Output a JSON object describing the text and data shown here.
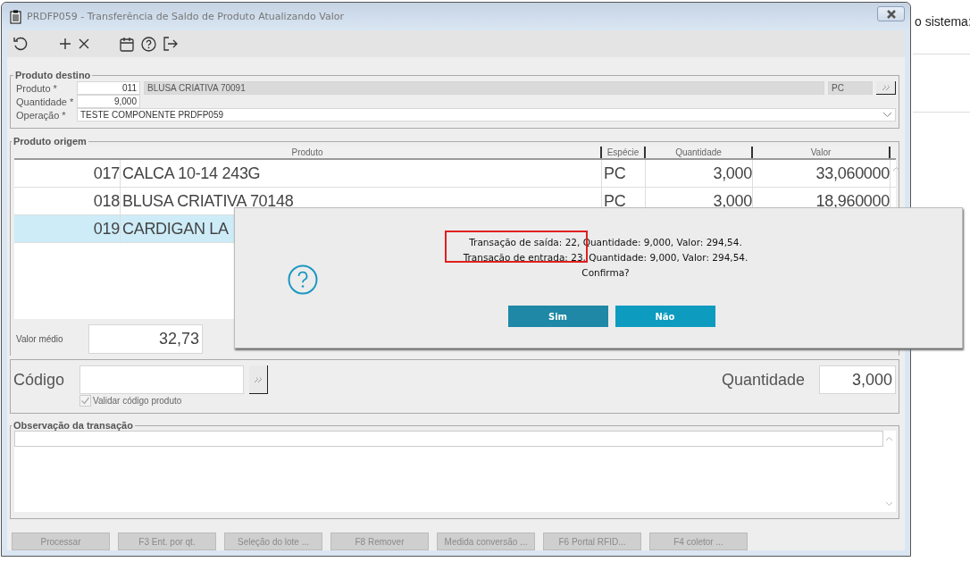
{
  "background": {
    "text": "o sistema:"
  },
  "window": {
    "title": "PRDFP059 - Transferência de Saldo de Produto Atualizando Valor"
  },
  "destino": {
    "title": "Produto destino",
    "fields": [
      {
        "label": "Produto *",
        "code": "011",
        "name": "BLUSA CRIATIVA 70091",
        "unit": "PC"
      },
      {
        "label": "Quantidade *",
        "value": "9,000"
      },
      {
        "label": "Operação *",
        "value": "TESTE COMPONENTE PRDFP059"
      }
    ]
  },
  "origem": {
    "title": "Produto origem",
    "table": {
      "columns": [
        "Produto",
        "Espécie",
        "Quantidade",
        "Valor"
      ],
      "rows": [
        {
          "product": {
            "code": "017",
            "name": "CALCA 10-14 243G"
          },
          "cells": [
            "PC",
            "3,000",
            "33,060000"
          ],
          "selected": false
        },
        {
          "product": {
            "code": "018",
            "name": "BLUSA CRIATIVA 70148"
          },
          "cells": [
            "PC",
            "3,000",
            "18,960000"
          ],
          "selected": false
        },
        {
          "product": {
            "code": "019",
            "name": "CARDIGAN LA"
          },
          "selected": true
        }
      ]
    },
    "average": {
      "label": "Valor médio",
      "value": "32,73"
    }
  },
  "codigo": {
    "label": "Código",
    "checkbox": {
      "label": "Validar código produto",
      "checked": true
    },
    "quantity_label": "Quantidade",
    "quantity": "3,000"
  },
  "observacao": {
    "title": "Observação da transação"
  },
  "buttons": [
    {
      "label": "Processar",
      "disabled": true
    },
    {
      "label": "F3 Ent. por qt.",
      "disabled": true
    },
    {
      "label": "Seleção do lote ...",
      "disabled": true
    },
    {
      "label": "F8 Remover",
      "disabled": true
    },
    {
      "label": "Medida conversão ...",
      "disabled": true
    },
    {
      "label": "F6 Portal RFID...",
      "disabled": true
    },
    {
      "label": "F4 coletor ...",
      "disabled": true
    }
  ],
  "dialog": {
    "lines": [
      "Transação de saída: 22, Quantidade: 9,000, Valor: 294,54.",
      "Transação de entrada: 23, Quantidade: 9,000, Valor: 294,54.",
      "Confirma?"
    ],
    "buttons": [
      {
        "label": "Sim",
        "default": true
      },
      {
        "label": "Não",
        "default": false
      }
    ]
  }
}
